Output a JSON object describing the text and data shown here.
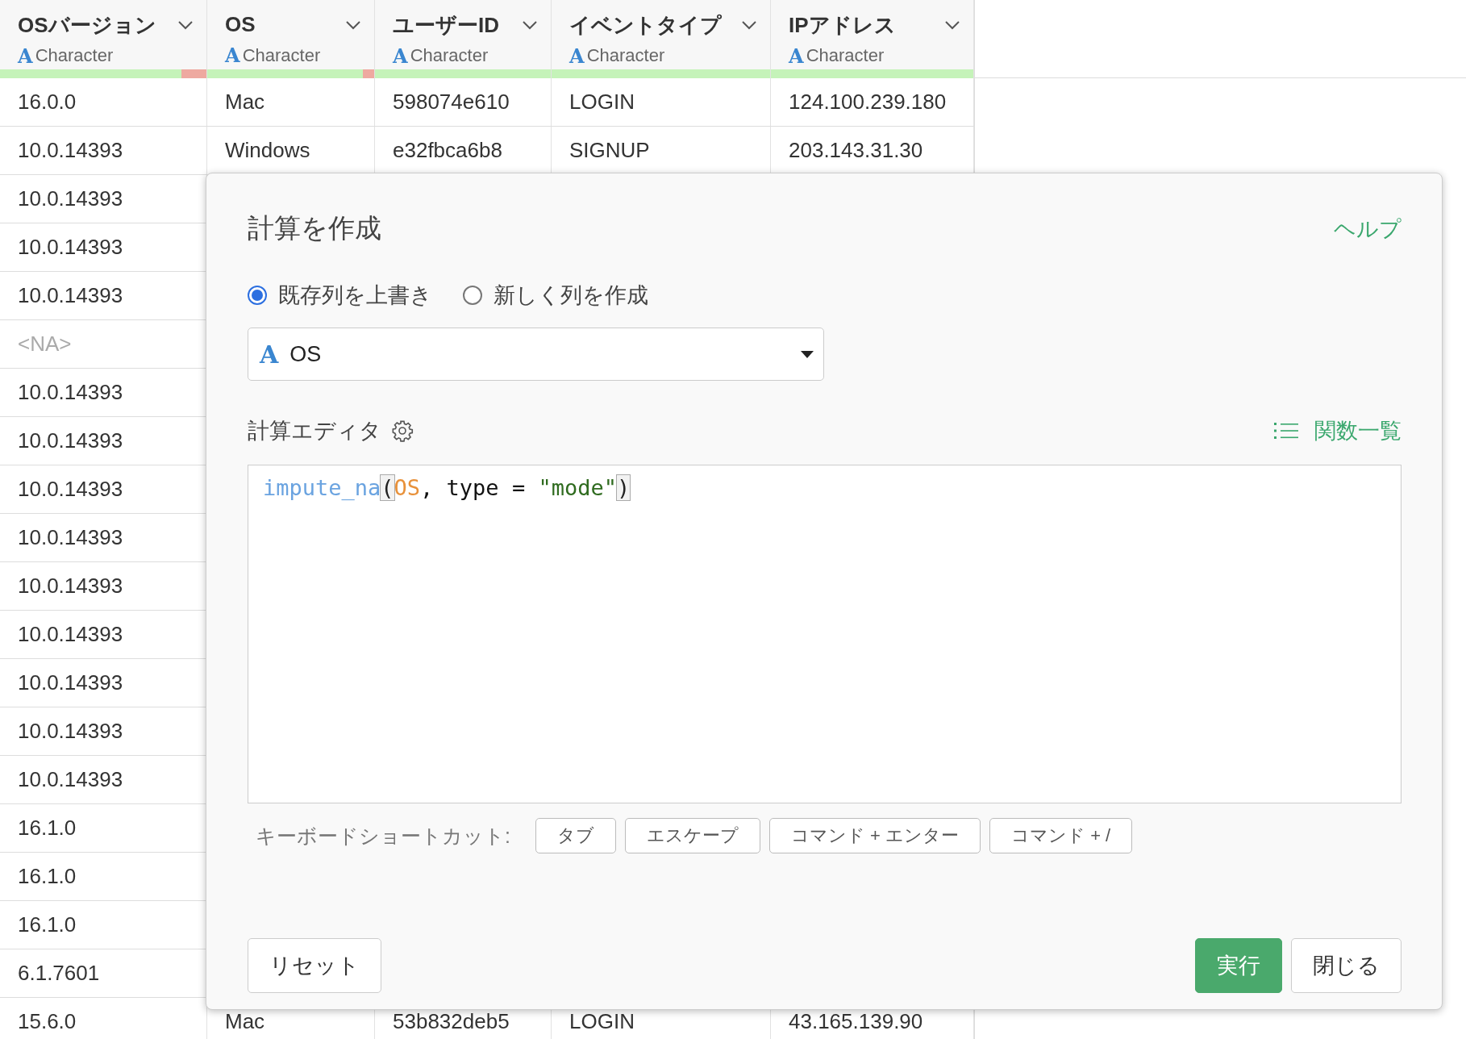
{
  "table": {
    "columns": [
      {
        "name": "OSバージョン",
        "type_glyph": "A",
        "type": "Character",
        "level": 0.88
      },
      {
        "name": "OS",
        "type_glyph": "A",
        "type": "Character",
        "level": 0.93
      },
      {
        "name": "ユーザーID",
        "type_glyph": "A",
        "type": "Character",
        "level": 1
      },
      {
        "name": "イベントタイプ",
        "type_glyph": "A",
        "type": "Character",
        "level": 1
      },
      {
        "name": "IPアドレス",
        "type_glyph": "A",
        "type": "Character",
        "level": 1
      }
    ],
    "rows": [
      {
        "cells": [
          {
            "text": "16.0.0",
            "missing": false
          },
          {
            "text": "Mac",
            "missing": false
          },
          {
            "text": "598074e610",
            "missing": false
          },
          {
            "text": "LOGIN",
            "missing": false
          },
          {
            "text": "124.100.239.180",
            "missing": false
          }
        ]
      },
      {
        "cells": [
          {
            "text": "10.0.14393",
            "missing": false
          },
          {
            "text": "Windows",
            "missing": false
          },
          {
            "text": "e32fbca6b8",
            "missing": false
          },
          {
            "text": "SIGNUP",
            "missing": false
          },
          {
            "text": "203.143.31.30",
            "missing": false
          }
        ]
      },
      {
        "cells": [
          {
            "text": "10.0.14393",
            "missing": false
          }
        ]
      },
      {
        "cells": [
          {
            "text": "10.0.14393",
            "missing": false
          }
        ]
      },
      {
        "cells": [
          {
            "text": "10.0.14393",
            "missing": false
          }
        ]
      },
      {
        "cells": [
          {
            "text": "<NA>",
            "missing": true
          }
        ]
      },
      {
        "cells": [
          {
            "text": "10.0.14393",
            "missing": false
          }
        ]
      },
      {
        "cells": [
          {
            "text": "10.0.14393",
            "missing": false
          }
        ]
      },
      {
        "cells": [
          {
            "text": "10.0.14393",
            "missing": false
          }
        ]
      },
      {
        "cells": [
          {
            "text": "10.0.14393",
            "missing": false
          }
        ]
      },
      {
        "cells": [
          {
            "text": "10.0.14393",
            "missing": false
          }
        ]
      },
      {
        "cells": [
          {
            "text": "10.0.14393",
            "missing": false
          }
        ]
      },
      {
        "cells": [
          {
            "text": "10.0.14393",
            "missing": false
          }
        ]
      },
      {
        "cells": [
          {
            "text": "10.0.14393",
            "missing": false
          }
        ]
      },
      {
        "cells": [
          {
            "text": "10.0.14393",
            "missing": false
          }
        ]
      },
      {
        "cells": [
          {
            "text": "16.1.0",
            "missing": false
          }
        ]
      },
      {
        "cells": [
          {
            "text": "16.1.0",
            "missing": false
          }
        ]
      },
      {
        "cells": [
          {
            "text": "16.1.0",
            "missing": false
          }
        ]
      },
      {
        "cells": [
          {
            "text": "6.1.7601",
            "missing": false
          }
        ]
      },
      {
        "cells": [
          {
            "text": "15.6.0",
            "missing": false
          },
          {
            "text": "Mac",
            "missing": false
          },
          {
            "text": "53b832deb5",
            "missing": false
          },
          {
            "text": "LOGIN",
            "missing": false
          },
          {
            "text": "43.165.139.90",
            "missing": false
          }
        ]
      }
    ]
  },
  "dialog": {
    "title": "計算を作成",
    "help_link": "ヘルプ",
    "mode_options": [
      {
        "label": "既存列を上書き",
        "selected": true
      },
      {
        "label": "新しく列を作成",
        "selected": false
      }
    ],
    "column_select": {
      "type_glyph": "A",
      "value": "OS"
    },
    "editor_label": "計算エディタ",
    "functions_link": "関数一覧",
    "code": [
      {
        "text": "impute_na",
        "kind": "function"
      },
      {
        "text": "(",
        "kind": "bracket"
      },
      {
        "text": "OS",
        "kind": "column"
      },
      {
        "text": ", type = ",
        "kind": "plain"
      },
      {
        "text": "\"mode\"",
        "kind": "string"
      },
      {
        "text": ")",
        "kind": "bracket"
      }
    ],
    "shortcuts_label": "キーボードショートカット:",
    "shortcuts": [
      "タブ",
      "エスケープ",
      "コマンド + エンター",
      "コマンド + /"
    ],
    "buttons": [
      {
        "label": "リセット",
        "kind": "default"
      },
      {
        "label": "実行",
        "kind": "primary"
      },
      {
        "label": "閉じる",
        "kind": "default"
      }
    ]
  }
}
